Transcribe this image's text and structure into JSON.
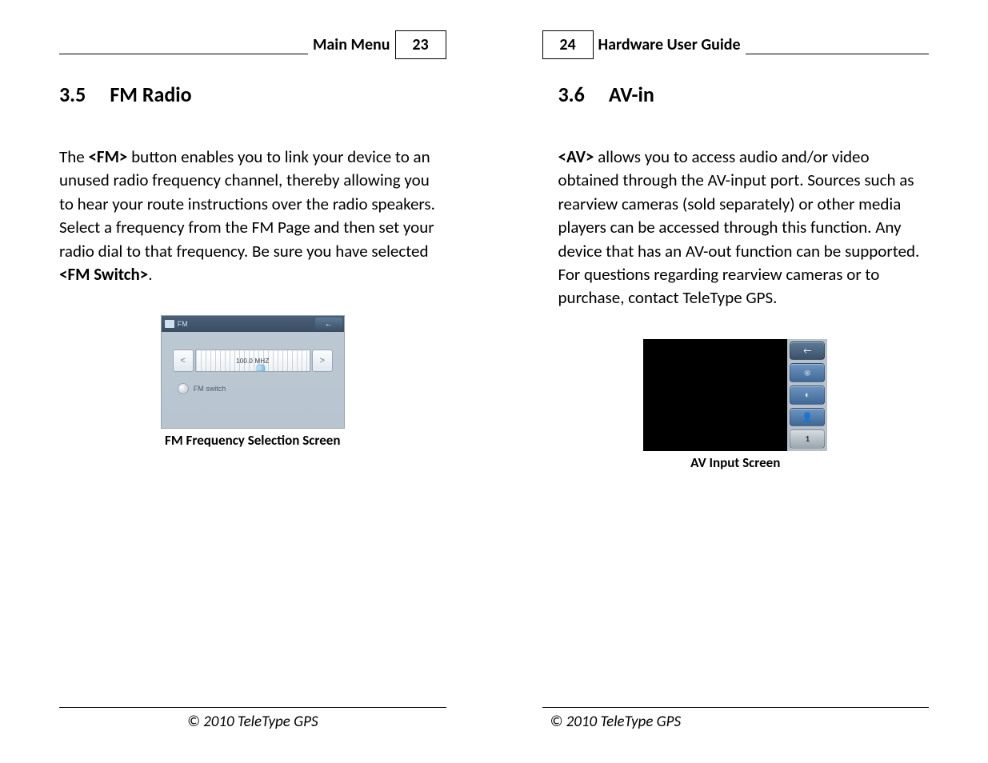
{
  "left": {
    "header": {
      "label": "Main Menu",
      "pageno": "23"
    },
    "section": {
      "num": "3.5",
      "title": "FM Radio"
    },
    "body": {
      "pre": "The ",
      "b1": "<FM>",
      "mid": " button enables you to link your device to an unused radio frequency channel, thereby allowing you to hear your route instructions over the radio speakers. Select a frequency from the FM Page and then set your radio dial to that frequency. Be sure you have selected ",
      "b2": "<FM Switch>",
      "post": "."
    },
    "fm_shot": {
      "title": "FM",
      "back_arrow": "←",
      "prev": "<",
      "next": ">",
      "freq": "100.0 MHZ",
      "switch": "FM switch"
    },
    "caption": "FM Frequency Selection Screen",
    "footer": "© 2010 TeleType GPS"
  },
  "right": {
    "header": {
      "label": "Hardware User Guide",
      "pageno": "24"
    },
    "section": {
      "num": "3.6",
      "title": "AV-in"
    },
    "body": {
      "b1": "<AV>",
      "rest": " allows you to access audio and/or video obtained through the AV-input port. Sources such as rearview cameras (sold separately) or other media players can be accessed through this function. Any device that has an AV-out function can be supported. For questions regarding rearview cameras or to purchase, contact TeleType GPS."
    },
    "av_shot": {
      "back_arrow": "←",
      "brightness": "☀",
      "contrast": "◐",
      "camera": "👤",
      "one": "1"
    },
    "caption": "AV Input Screen",
    "footer": "© 2010 TeleType GPS"
  }
}
